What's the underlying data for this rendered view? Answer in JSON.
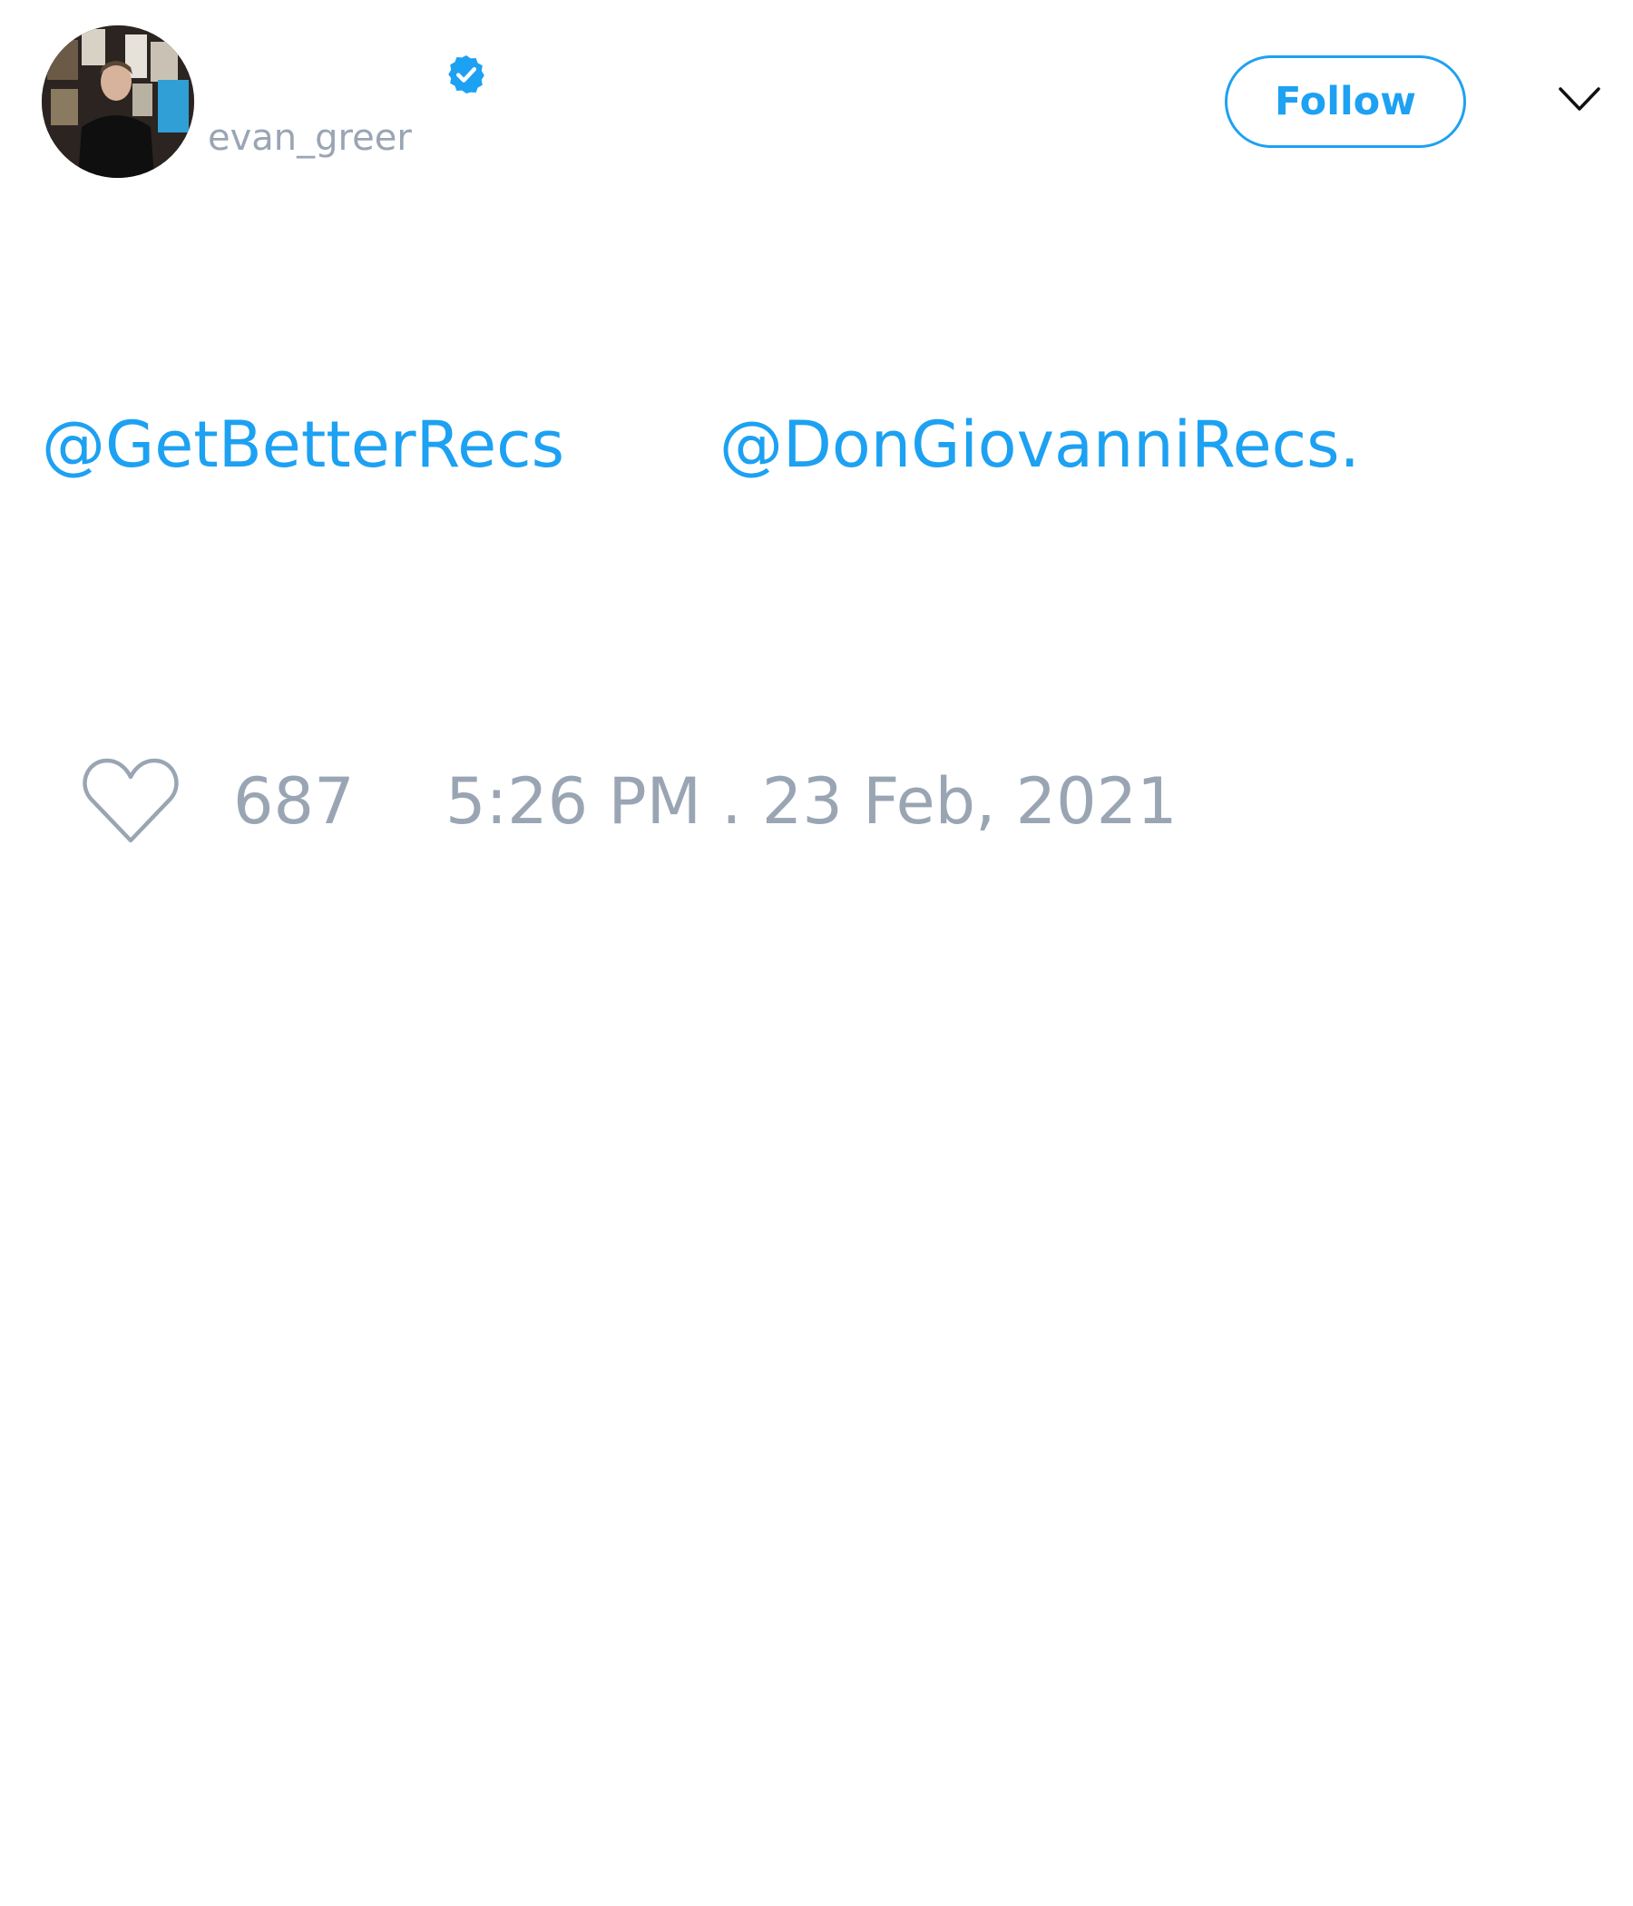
{
  "author": {
    "handle": "evan_greer",
    "verified": true
  },
  "header": {
    "follow_label": "Follow",
    "menu_icon": "chevron-down-icon"
  },
  "tweet": {
    "mention_1": "@GetBetterRecs",
    "mention_2": "@DonGiovanniRecs."
  },
  "footer": {
    "like_icon": "heart-icon",
    "like_count": "687",
    "timestamp": "5:26 PM . 23 Feb, 2021"
  },
  "colors": {
    "accent": "#1da1f2",
    "muted_text": "#9aa5b4",
    "background": "#ffffff"
  }
}
